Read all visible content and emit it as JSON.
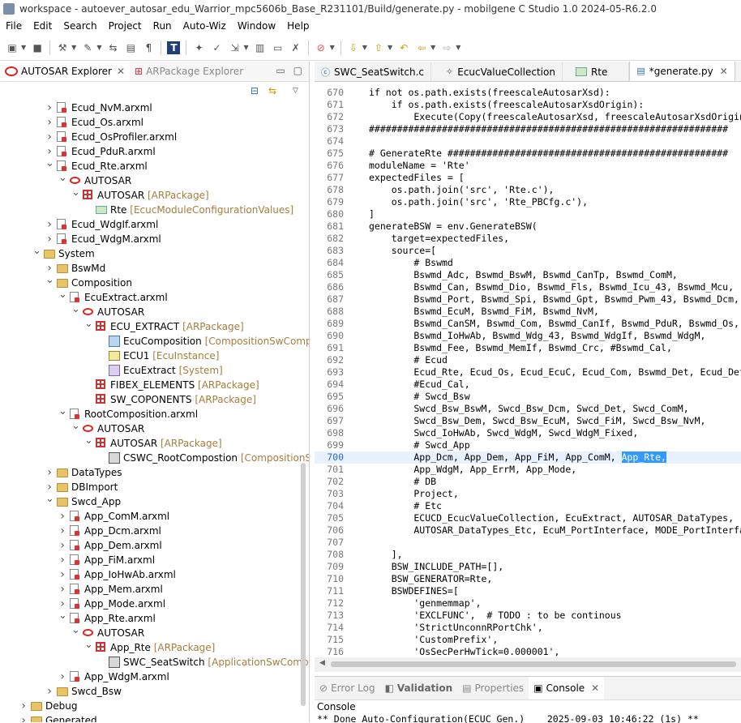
{
  "window": {
    "title": "workspace - autoever_autosar_edu_Warrior_mpc5606b_Base_R231101/Build/generate.py - mobilgene C Studio 1.0 2024-05-R6.2.0"
  },
  "menu": [
    "File",
    "Edit",
    "Search",
    "Project",
    "Run",
    "Auto-Wiz",
    "Window",
    "Help"
  ],
  "left": {
    "tabs": [
      {
        "label": "AUTOSAR Explorer"
      },
      {
        "label": "ARPackage Explorer"
      }
    ],
    "tree": [
      {
        "d": 4,
        "a": "r",
        "i": "file",
        "label": "Ecud_NvM.arxml",
        "t": ""
      },
      {
        "d": 4,
        "a": "r",
        "i": "file",
        "label": "Ecud_Os.arxml",
        "t": ""
      },
      {
        "d": 4,
        "a": "r",
        "i": "file",
        "label": "Ecud_OsProfiler.arxml",
        "t": ""
      },
      {
        "d": 4,
        "a": "r",
        "i": "file",
        "label": "Ecud_PduR.arxml",
        "t": ""
      },
      {
        "d": 4,
        "a": "d",
        "i": "file",
        "label": "Ecud_Rte.arxml",
        "t": ""
      },
      {
        "d": 5,
        "a": "d",
        "i": "autosar",
        "label": "AUTOSAR",
        "t": ""
      },
      {
        "d": 6,
        "a": "d",
        "i": "pkg",
        "label": "AUTOSAR",
        "t": "[ARPackage]"
      },
      {
        "d": 7,
        "a": "",
        "i": "rte",
        "label": "Rte",
        "t": "[EcucModuleConfigurationValues]"
      },
      {
        "d": 4,
        "a": "r",
        "i": "file",
        "label": "Ecud_WdgIf.arxml",
        "t": ""
      },
      {
        "d": 4,
        "a": "r",
        "i": "file",
        "label": "Ecud_WdgM.arxml",
        "t": ""
      },
      {
        "d": 3,
        "a": "d",
        "i": "folder",
        "label": "System",
        "t": ""
      },
      {
        "d": 4,
        "a": "r",
        "i": "folder",
        "label": "BswMd",
        "t": ""
      },
      {
        "d": 4,
        "a": "d",
        "i": "folder",
        "label": "Composition",
        "t": ""
      },
      {
        "d": 5,
        "a": "d",
        "i": "file",
        "label": "EcuExtract.arxml",
        "t": ""
      },
      {
        "d": 6,
        "a": "d",
        "i": "autosar",
        "label": "AUTOSAR",
        "t": ""
      },
      {
        "d": 7,
        "a": "d",
        "i": "pkg",
        "label": "ECU_EXTRACT",
        "t": "[ARPackage]"
      },
      {
        "d": 8,
        "a": "",
        "i": "comp",
        "label": "EcuComposition",
        "t": "[CompositionSwComponentType]"
      },
      {
        "d": 8,
        "a": "",
        "i": "ecu",
        "label": "ECU1",
        "t": "[EcuInstance]"
      },
      {
        "d": 8,
        "a": "",
        "i": "sys",
        "label": "EcuExtract",
        "t": "[System]"
      },
      {
        "d": 7,
        "a": "",
        "i": "pkg",
        "label": "FIBEX_ELEMENTS",
        "t": "[ARPackage]"
      },
      {
        "d": 7,
        "a": "",
        "i": "pkg",
        "label": "SW_COPONENTS",
        "t": "[ARPackage]"
      },
      {
        "d": 5,
        "a": "d",
        "i": "file",
        "label": "RootComposition.arxml",
        "t": ""
      },
      {
        "d": 6,
        "a": "d",
        "i": "autosar",
        "label": "AUTOSAR",
        "t": ""
      },
      {
        "d": 7,
        "a": "d",
        "i": "pkg",
        "label": "AUTOSAR",
        "t": "[ARPackage]"
      },
      {
        "d": 8,
        "a": "",
        "i": "swc",
        "label": "CSWC_RootCompostion",
        "t": "[CompositionSwComponentType]"
      },
      {
        "d": 4,
        "a": "r",
        "i": "folder",
        "label": "DataTypes",
        "t": ""
      },
      {
        "d": 4,
        "a": "r",
        "i": "folder",
        "label": "DBImport",
        "t": ""
      },
      {
        "d": 4,
        "a": "d",
        "i": "folder",
        "label": "Swcd_App",
        "t": ""
      },
      {
        "d": 5,
        "a": "r",
        "i": "file",
        "label": "App_ComM.arxml",
        "t": ""
      },
      {
        "d": 5,
        "a": "r",
        "i": "file",
        "label": "App_Dcm.arxml",
        "t": ""
      },
      {
        "d": 5,
        "a": "r",
        "i": "file",
        "label": "App_Dem.arxml",
        "t": ""
      },
      {
        "d": 5,
        "a": "r",
        "i": "file",
        "label": "App_FiM.arxml",
        "t": ""
      },
      {
        "d": 5,
        "a": "r",
        "i": "file",
        "label": "App_IoHwAb.arxml",
        "t": ""
      },
      {
        "d": 5,
        "a": "r",
        "i": "file",
        "label": "App_Mem.arxml",
        "t": ""
      },
      {
        "d": 5,
        "a": "r",
        "i": "file",
        "label": "App_Mode.arxml",
        "t": ""
      },
      {
        "d": 5,
        "a": "d",
        "i": "file",
        "label": "App_Rte.arxml",
        "t": ""
      },
      {
        "d": 6,
        "a": "d",
        "i": "autosar",
        "label": "AUTOSAR",
        "t": ""
      },
      {
        "d": 7,
        "a": "d",
        "i": "pkg",
        "label": "App_Rte",
        "t": "[ARPackage]"
      },
      {
        "d": 8,
        "a": "",
        "i": "swc",
        "label": "SWC_SeatSwitch",
        "t": "[ApplicationSwComponentType]"
      },
      {
        "d": 5,
        "a": "r",
        "i": "file",
        "label": "App_WdgM.arxml",
        "t": ""
      },
      {
        "d": 4,
        "a": "r",
        "i": "folder",
        "label": "Swcd_Bsw",
        "t": ""
      },
      {
        "d": 2,
        "a": "r",
        "i": "folder",
        "label": "Debug",
        "t": ""
      },
      {
        "d": 2,
        "a": "r",
        "i": "folder",
        "label": "Generated",
        "t": ""
      }
    ]
  },
  "editor": {
    "tabs": [
      {
        "label": "SWC_SeatSwitch.c",
        "icon": "c-file-icon"
      },
      {
        "label": "EcucValueCollection",
        "icon": "diamond-icon"
      },
      {
        "label": "Rte",
        "icon": "rte-icon"
      },
      {
        "label": "*generate.py",
        "icon": "python-file-icon",
        "active": true
      }
    ],
    "current_line": "700",
    "selection": "App_Rte,",
    "lines": [
      {
        "n": "670",
        "t": "if not os.path.exists(freescaleAutosarXsd):"
      },
      {
        "n": "671",
        "t": "    if os.path.exists(freescaleAutosarXsdOrigin):"
      },
      {
        "n": "672",
        "t": "        Execute(Copy(freescaleAutosarXsd, freescaleAutosarXsdOrigin))"
      },
      {
        "n": "673",
        "t": "################################################################"
      },
      {
        "n": "674",
        "t": ""
      },
      {
        "n": "675",
        "t": "# GenerateRte ##################################################"
      },
      {
        "n": "676",
        "t": "moduleName = 'Rte'"
      },
      {
        "n": "677",
        "t": "expectedFiles = ["
      },
      {
        "n": "678",
        "t": "    os.path.join('src', 'Rte.c'),"
      },
      {
        "n": "679",
        "t": "    os.path.join('src', 'Rte_PBCfg.c'),"
      },
      {
        "n": "680",
        "t": "]"
      },
      {
        "n": "681",
        "t": "generateBSW = env.GenerateBSW("
      },
      {
        "n": "682",
        "t": "    target=expectedFiles,"
      },
      {
        "n": "683",
        "t": "    source=["
      },
      {
        "n": "684",
        "t": "        # Bswmd"
      },
      {
        "n": "685",
        "t": "        Bswmd_Adc, Bswmd_BswM, Bswmd_CanTp, Bswmd_ComM,"
      },
      {
        "n": "686",
        "t": "        Bswmd_Can, Bswmd_Dio, Bswmd_Fls, Bswmd_Icu_43, Bswmd_Mcu,"
      },
      {
        "n": "687",
        "t": "        Bswmd_Port, Bswmd_Spi, Bswmd_Gpt, Bswmd_Pwm_43, Bswmd_Dcm,"
      },
      {
        "n": "688",
        "t": "        Bswmd_EcuM, Bswmd_FiM, Bswmd_NvM,"
      },
      {
        "n": "689",
        "t": "        Bswmd_CanSM, Bswmd_Com, Bswmd_CanIf, Bswmd_PduR, Bswmd_Os,"
      },
      {
        "n": "690",
        "t": "        Bswmd_IoHwAb, Bswmd_Wdg_43, Bswmd_WdgIf, Bswmd_WdgM,"
      },
      {
        "n": "691",
        "t": "        Bswmd_Fee, Bswmd_MemIf, Bswmd_Crc, #Bswmd_Cal,"
      },
      {
        "n": "692",
        "t": "        # Ecud"
      },
      {
        "n": "693",
        "t": "        Ecud_Rte, Ecud_Os, Ecud_EcuC, Ecud_Com, Bswmd_Det, Ecud_Det,"
      },
      {
        "n": "694",
        "t": "        #Ecud_Cal,"
      },
      {
        "n": "695",
        "t": "        # Swcd_Bsw"
      },
      {
        "n": "696",
        "t": "        Swcd_Bsw_BswM, Swcd_Bsw_Dcm, Swcd_Det, Swcd_ComM,"
      },
      {
        "n": "697",
        "t": "        Swcd_Bsw_Dem, Swcd_Bsw_EcuM, Swcd_FiM, Swcd_Bsw_NvM,"
      },
      {
        "n": "698",
        "t": "        Swcd_IoHwAb, Swcd_WdgM, Swcd_WdgM_Fixed,"
      },
      {
        "n": "699",
        "t": "        # Swcd_App"
      },
      {
        "n": "700",
        "t": "        App_Dcm, App_Dem, App_FiM, App_ComM, ",
        "sel": "App_Rte,"
      },
      {
        "n": "701",
        "t": "        App_WdgM, App_ErrM, App_Mode,"
      },
      {
        "n": "702",
        "t": "        # DB"
      },
      {
        "n": "703",
        "t": "        Project,"
      },
      {
        "n": "704",
        "t": "        # Etc"
      },
      {
        "n": "705",
        "t": "        ECUCD_EcucValueCollection, EcuExtract, AUTOSAR_DataTypes,"
      },
      {
        "n": "706",
        "t": "        AUTOSAR_DataTypes_Etc, EcuM_PortInterface, MODE_PortInterface,"
      },
      {
        "n": "707",
        "t": ""
      },
      {
        "n": "708",
        "t": "    ],"
      },
      {
        "n": "709",
        "t": "    BSW_INCLUDE_PATH=[],"
      },
      {
        "n": "710",
        "t": "    BSW_GENERATOR=Rte,"
      },
      {
        "n": "711",
        "t": "    BSWDEFINES=["
      },
      {
        "n": "712",
        "t": "        'genmemmap',"
      },
      {
        "n": "713",
        "t": "        'EXCLFUNC',  # TODO : to be continous"
      },
      {
        "n": "714",
        "t": "        'StrictUnconnRPortChk',"
      },
      {
        "n": "715",
        "t": "        'CustomPrefix',"
      },
      {
        "n": "716",
        "t": "        'OsSecPerHwTick=0.000001',"
      }
    ]
  },
  "bottom": {
    "tabs": [
      {
        "label": "Error Log",
        "bold": false
      },
      {
        "label": "Validation",
        "bold": true
      },
      {
        "label": "Properties",
        "bold": false
      },
      {
        "label": "Console",
        "bold": false,
        "active": true
      }
    ],
    "console_title": "Console",
    "console_line": "** Done Auto-Configuration(ECUC Gen.)    2025-09-03 10:46:22 (1s) **"
  }
}
